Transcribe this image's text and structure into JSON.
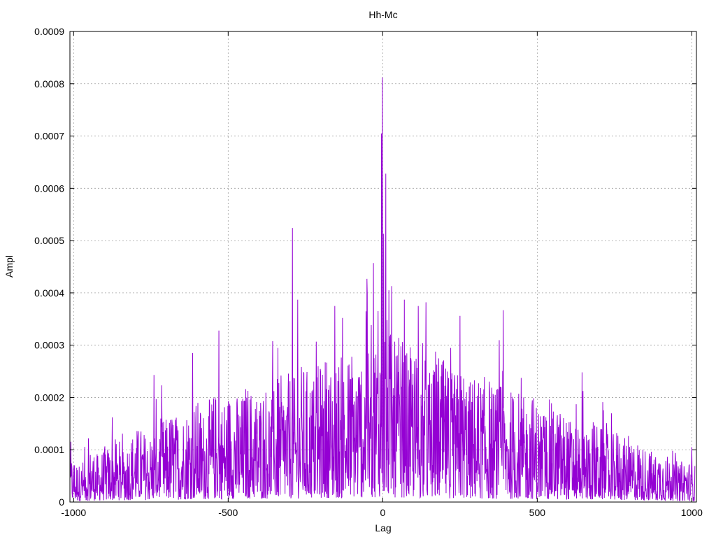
{
  "chart_data": {
    "type": "line",
    "title": "Hh-Mc",
    "xlabel": "Lag",
    "ylabel": "Ampl",
    "xlim": [
      -1012,
      1015
    ],
    "ylim": [
      0,
      0.0009
    ],
    "grid": true,
    "legend": "none",
    "x_ticks": [
      -1000,
      -500,
      0,
      500,
      1000
    ],
    "x_tick_labels": [
      "-1000",
      "-500",
      "0",
      "500",
      "1000"
    ],
    "y_ticks": [
      0,
      0.0001,
      0.0002,
      0.0003,
      0.0004,
      0.0005,
      0.0006,
      0.0007,
      0.0008,
      0.0009
    ],
    "y_tick_labels": [
      "0",
      "0.0001",
      "0.0002",
      "0.0003",
      "0.0004",
      "0.0005",
      "0.0006",
      "0.0007",
      "0.0008",
      "0.0009"
    ],
    "series": [
      {
        "color": "#9400d3",
        "x": [
          -1000,
          -980,
          -960,
          -940,
          -920,
          -900,
          -880,
          -860,
          -840,
          -820,
          -800,
          -780,
          -760,
          -740,
          -720,
          -700,
          -680,
          -660,
          -640,
          -620,
          -600,
          -580,
          -560,
          -540,
          -520,
          -500,
          -480,
          -460,
          -440,
          -420,
          -400,
          -380,
          -360,
          -340,
          -320,
          -300,
          -280,
          -260,
          -240,
          -220,
          -200,
          -180,
          -160,
          -140,
          -120,
          -100,
          -80,
          -60,
          -40,
          -20,
          0,
          20,
          40,
          60,
          80,
          100,
          120,
          140,
          160,
          180,
          200,
          220,
          240,
          260,
          280,
          300,
          320,
          340,
          360,
          380,
          400,
          420,
          440,
          460,
          480,
          500,
          520,
          540,
          560,
          580,
          600,
          620,
          640,
          660,
          680,
          700,
          720,
          740,
          760,
          780,
          800,
          820,
          840,
          860,
          880,
          900,
          920,
          940,
          960,
          980,
          1000
        ],
        "y": [
          5e-05,
          4e-05,
          5e-05,
          6e-05,
          5e-05,
          6e-05,
          6e-05,
          7e-05,
          6e-05,
          7e-05,
          8e-05,
          8e-05,
          7e-05,
          8e-05,
          9e-05,
          9e-05,
          0.0001,
          9e-05,
          0.0001,
          0.00011,
          0.00011,
          0.0001,
          0.00011,
          0.00012,
          0.00011,
          0.00012,
          0.00012,
          0.00011,
          0.00013,
          0.00012,
          0.00012,
          0.00013,
          0.00012,
          0.00014,
          0.00013,
          0.00014,
          0.00013,
          0.00015,
          0.00014,
          0.00014,
          0.00015,
          0.00016,
          0.00014,
          0.00016,
          0.00015,
          0.00017,
          0.00016,
          0.00018,
          0.00017,
          0.00019,
          0.00022,
          0.00019,
          0.00017,
          0.00018,
          0.00016,
          0.00017,
          0.00015,
          0.00016,
          0.00014,
          0.00016,
          0.00015,
          0.00014,
          0.00014,
          0.00015,
          0.00013,
          0.00014,
          0.00013,
          0.00014,
          0.00012,
          0.00013,
          0.00012,
          0.00012,
          0.00012,
          0.00011,
          0.00012,
          0.00011,
          0.0001,
          0.00011,
          0.0001,
          0.0001,
          9e-05,
          9e-05,
          0.0001,
          8e-05,
          9e-05,
          8e-05,
          8e-05,
          7e-05,
          8e-05,
          7e-05,
          6e-05,
          7e-05,
          6e-05,
          6e-05,
          5e-05,
          6e-05,
          5e-05,
          5e-05,
          4e-05,
          5e-05,
          4e-05
        ]
      }
    ],
    "peaks": [
      {
        "x": -1,
        "y": 0.000812
      },
      {
        "x": -4,
        "y": 0.000705
      },
      {
        "x": 10,
        "y": 0.000628
      },
      {
        "x": -292,
        "y": 0.000524
      },
      {
        "x": 3,
        "y": 0.000513
      },
      {
        "x": -30,
        "y": 0.000457
      },
      {
        "x": 70,
        "y": 0.000387
      },
      {
        "x": 140,
        "y": 0.000382
      },
      {
        "x": 115,
        "y": 0.000375
      },
      {
        "x": -275,
        "y": 0.000387
      },
      {
        "x": -530,
        "y": 0.000328
      },
      {
        "x": 390,
        "y": 0.000367
      },
      {
        "x": 20,
        "y": 0.000405
      },
      {
        "x": -50,
        "y": 0.000398
      },
      {
        "x": -15,
        "y": 0.000365
      },
      {
        "x": 250,
        "y": 0.000356
      },
      {
        "x": -130,
        "y": 0.000352
      },
      {
        "x": -155,
        "y": 0.000375
      },
      {
        "x": 645,
        "y": 0.000248
      },
      {
        "x": -740,
        "y": 0.000243
      },
      {
        "x": -615,
        "y": 0.000285
      },
      {
        "x": -875,
        "y": 0.000162
      },
      {
        "x": 1000,
        "y": 0.000105
      }
    ]
  }
}
